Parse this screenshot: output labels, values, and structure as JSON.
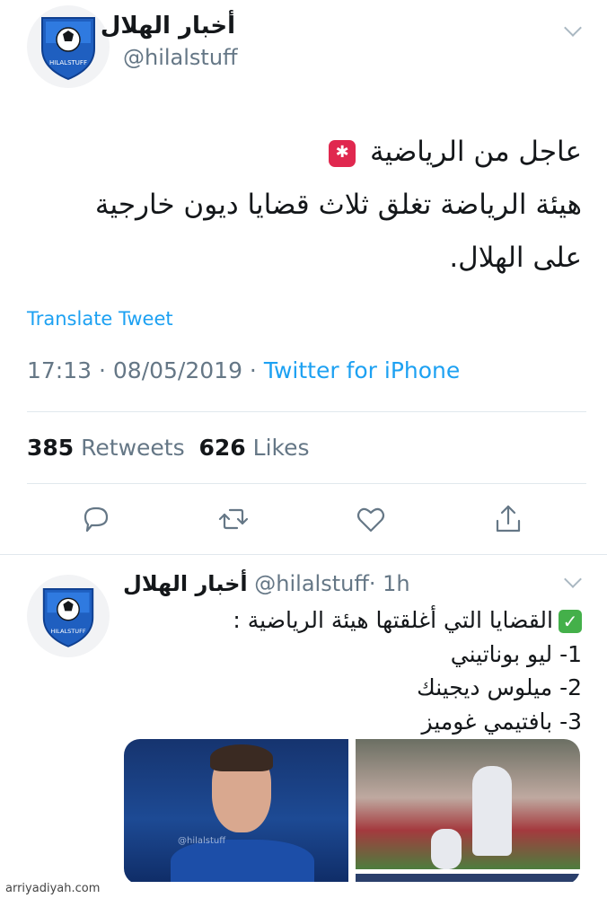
{
  "tweet": {
    "author_name": "أخبار الهلال",
    "author_handle": "@hilalstuff",
    "avatar_text": "HILALSTUFF",
    "text_line1": "عاجل من الرياضية",
    "text_line2": "هيئة الرياضة تغلق ثلاث قضايا ديون خارجية",
    "text_line3": "على الهلال.",
    "translate_label": "Translate Tweet",
    "time": "17:13",
    "date": "08/05/2019",
    "source": "Twitter for iPhone",
    "retweets_count": "385",
    "retweets_label": "Retweets",
    "likes_count": "626",
    "likes_label": "Likes"
  },
  "reply": {
    "author_name": "أخبار الهلال",
    "author_handle": "@hilalstuff",
    "time_ago": "· 1h",
    "line1": "القضايا التي أغلقتها هيئة الرياضية :",
    "line2": "1- ليو بوناتيني",
    "line3": "2- ميلوس ديجينك",
    "line4": "3- بافتيمي غوميز",
    "image_watermark": "@hilalstuff"
  },
  "icons": [
    "shield-logo-icon",
    "siren-emoji-icon",
    "check-emoji-icon",
    "reply-icon",
    "retweet-icon",
    "like-icon",
    "share-icon",
    "chevron-down-icon"
  ],
  "colors": {
    "link": "#1da1f2",
    "muted": "#657786",
    "text": "#14171a",
    "divider": "#e1e8ed"
  },
  "footer": {
    "source_site": "arriyadiyah.com"
  }
}
